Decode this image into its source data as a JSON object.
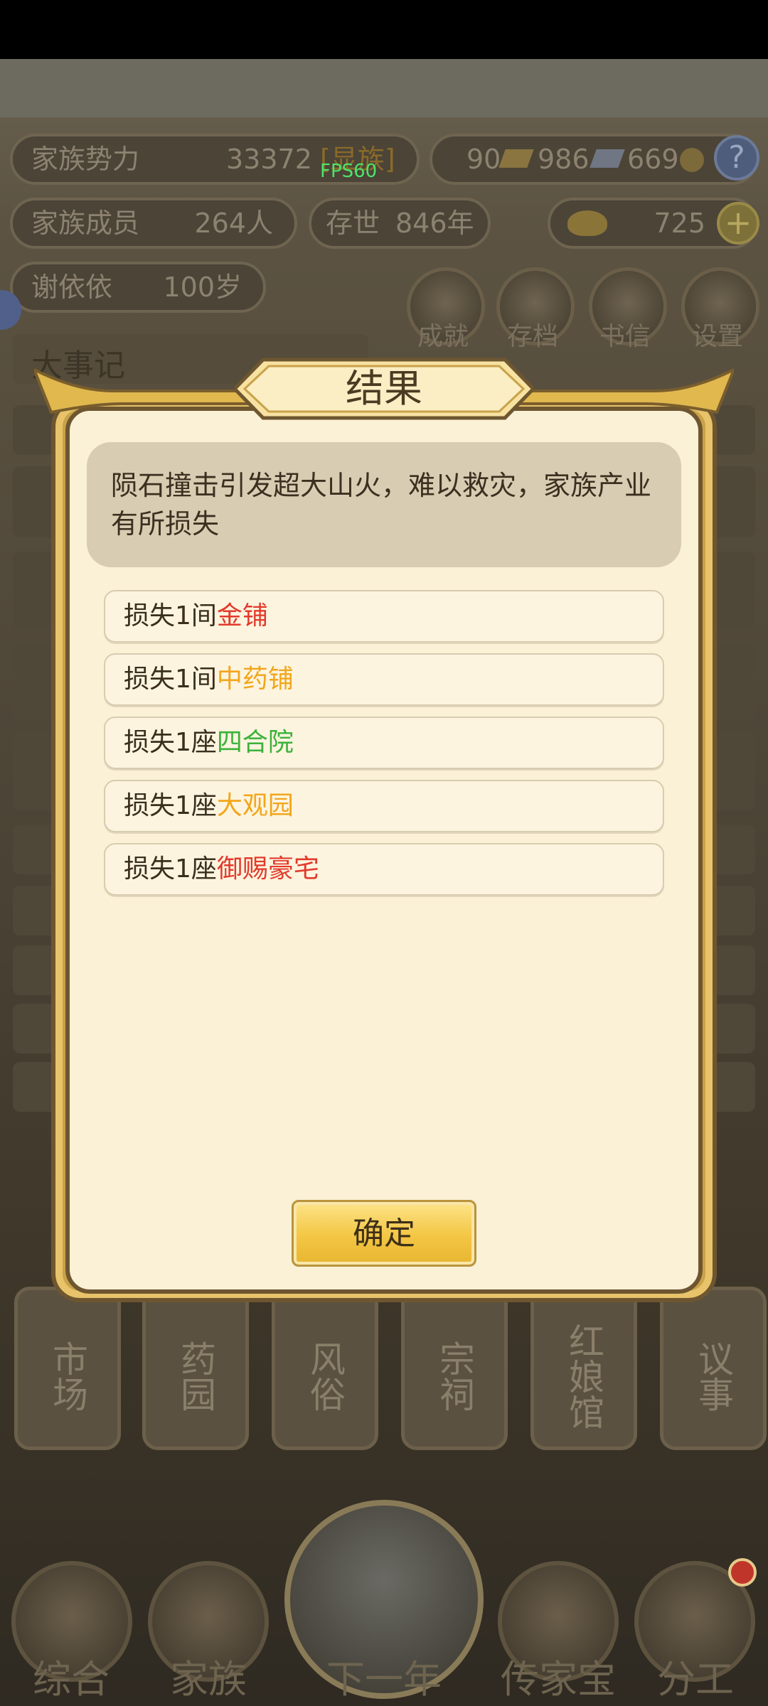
{
  "fps": "FPS60",
  "hud": {
    "power_label": "家族势力",
    "power_value": "33372",
    "power_rank": "[显族]",
    "currency_1": "90",
    "currency_2": "986",
    "currency_3": "669",
    "members_label": "家族成员",
    "members_value": "264人",
    "exist_label": "存世",
    "exist_value": "846年",
    "ingot_value": "725",
    "leader_name": "谢依依",
    "leader_age": "100岁",
    "help": "?",
    "add": "+"
  },
  "round_buttons": [
    "成就",
    "存档",
    "书信",
    "设置"
  ],
  "chronicle_title": "大事记",
  "buildings": [
    "市场",
    "药园",
    "风俗",
    "宗祠",
    "红娘馆",
    "议事"
  ],
  "bottom_nav": [
    "综合",
    "家族",
    "下一年",
    "传家宝",
    "分工"
  ],
  "dialog": {
    "title": "结果",
    "message": "陨石撞击引发超大山火，难以救灾，家族产业有所损失",
    "losses": [
      {
        "prefix": "损失1间",
        "name": "金铺",
        "color": "red"
      },
      {
        "prefix": "损失1间",
        "name": "中药铺",
        "color": "orange"
      },
      {
        "prefix": "损失1座",
        "name": "四合院",
        "color": "green"
      },
      {
        "prefix": "损失1座",
        "name": "大观园",
        "color": "orange"
      },
      {
        "prefix": "损失1座",
        "name": "御赐豪宅",
        "color": "red"
      }
    ],
    "confirm": "确定"
  }
}
